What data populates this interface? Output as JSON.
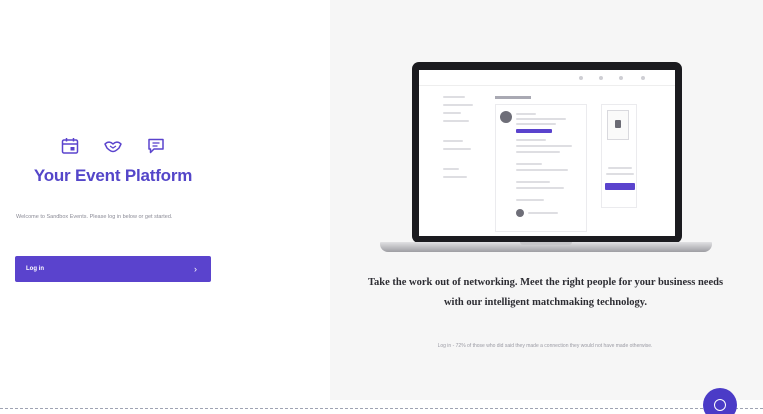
{
  "brand": {
    "icons": [
      "calendar-icon",
      "handshake-icon",
      "chat-icon"
    ],
    "title": "Your Event Platform",
    "accent_color": "#5a43cd"
  },
  "welcome": {
    "text": "Welcome to Sandbox Events. Please log in below or get started."
  },
  "login": {
    "label": "Log in",
    "arrow": "›"
  },
  "promo": {
    "tagline": "Take the work out of networking. Meet the right people for your business needs with our intelligent matchmaking technology.",
    "subtext": "Log in - 72% of those who did said they made a connection they would not have made otherwise."
  },
  "help": {
    "icon": "help-chat-icon"
  }
}
